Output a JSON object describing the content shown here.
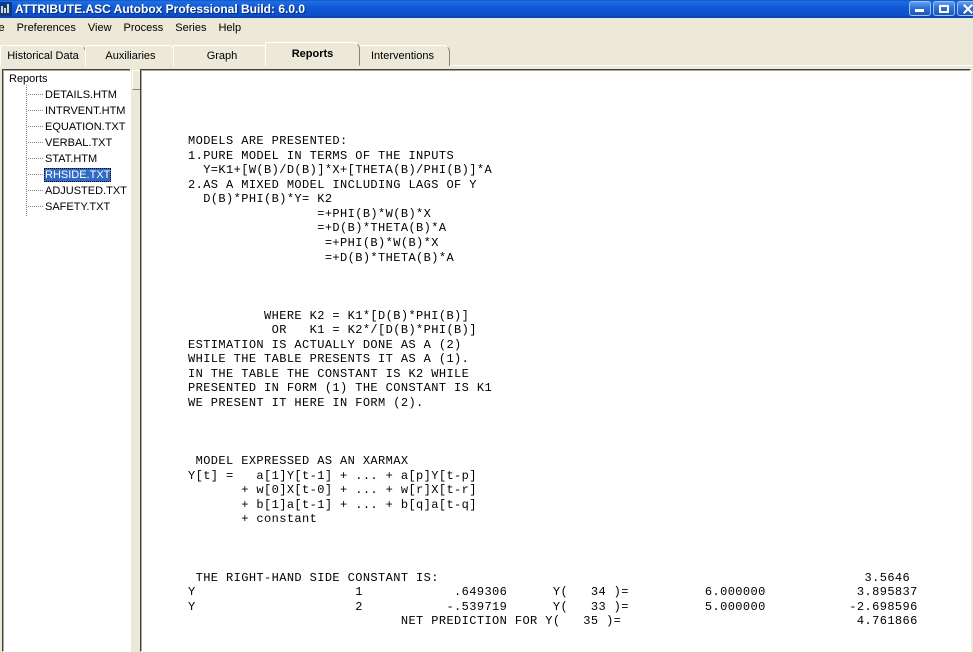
{
  "window": {
    "title": "ATTRIBUTE.ASC  Autobox Professional Build: 6.0.0",
    "icon": "app-icon",
    "buttons": [
      {
        "name": "minimize-button",
        "glyph": "minimize-icon"
      },
      {
        "name": "maximize-button",
        "glyph": "maximize-icon"
      },
      {
        "name": "close-button",
        "glyph": "close-icon"
      }
    ]
  },
  "menubar": {
    "items": [
      {
        "label": "le"
      },
      {
        "label": "Preferences"
      },
      {
        "label": "View"
      },
      {
        "label": "Process"
      },
      {
        "label": "Series"
      },
      {
        "label": "Help"
      }
    ]
  },
  "tabs": {
    "active": "Reports",
    "items": [
      {
        "label": "Historical Data",
        "left": 0,
        "width": 86,
        "active": false
      },
      {
        "label": "Auxiliaries",
        "left": 85,
        "width": 91,
        "active": false
      },
      {
        "label": "Graph",
        "left": 173,
        "width": 98,
        "active": false
      },
      {
        "label": "Reports",
        "left": 265,
        "width": 95,
        "active": true
      },
      {
        "label": "Interventions",
        "left": 355,
        "width": 95,
        "active": false
      }
    ]
  },
  "tree": {
    "root_label": "Reports",
    "items": [
      {
        "label": "DETAILS.HTM",
        "selected": false
      },
      {
        "label": "INTRVENT.HTM",
        "selected": false
      },
      {
        "label": "EQUATION.TXT",
        "selected": false
      },
      {
        "label": "VERBAL.TXT",
        "selected": false
      },
      {
        "label": "STAT.HTM",
        "selected": false
      },
      {
        "label": "RHSIDE.TXT",
        "selected": true
      },
      {
        "label": "ADJUSTED.TXT",
        "selected": false
      },
      {
        "label": "SAFETY.TXT",
        "selected": false
      }
    ]
  },
  "report": {
    "filename": "RHSIDE.TXT",
    "body": "\n\n\n\n     MODELS ARE PRESENTED:\n     1.PURE MODEL IN TERMS OF THE INPUTS\n       Y=K1+[W(B)/D(B)]*X+[THETA(B)/PHI(B)]*A\n     2.AS A MIXED MODEL INCLUDING LAGS OF Y\n       D(B)*PHI(B)*Y= K2\n                      =+PHI(B)*W(B)*X\n                      =+D(B)*THETA(B)*A\n                       =+PHI(B)*W(B)*X\n                       =+D(B)*THETA(B)*A\n\n\n\n               WHERE K2 = K1*[D(B)*PHI(B)]\n                OR   K1 = K2*/[D(B)*PHI(B)]\n     ESTIMATION IS ACTUALLY DONE AS A (2)\n     WHILE THE TABLE PRESENTS IT AS A (1).\n     IN THE TABLE THE CONSTANT IS K2 WHILE\n     PRESENTED IN FORM (1) THE CONSTANT IS K1\n     WE PRESENT IT HERE IN FORM (2).\n\n\n\n      MODEL EXPRESSED AS AN XARMAX\n     Y[t] =   a[1]Y[t-1] + ... + a[p]Y[t-p]\n            + w[0]X[t-0] + ... + w[r]X[t-r]\n            + b[1]a[t-1] + ... + b[q]a[t-q]\n            + constant\n\n\n\n      THE RIGHT-HAND SIDE CONSTANT IS:                                                        3.5646\n     Y                     1            .649306      Y(   34 )=          6.000000            3.895837\n     Y                     2           -.539719      Y(   33 )=          5.000000           -2.698596\n                                 NET PREDICTION FOR Y(   35 )=                               4.761866"
  },
  "report_values": {
    "rhs_constant_label": "THE RIGHT-HAND SIDE CONSTANT IS:",
    "rhs_constant": "3.5646",
    "rows": [
      {
        "series": "Y",
        "lag": "1",
        "coefficient": ".649306",
        "ref_label": "Y(",
        "ref_index": "34",
        "ref_value": "6.000000",
        "contribution": "3.895837"
      },
      {
        "series": "Y",
        "lag": "2",
        "coefficient": "-.539719",
        "ref_label": "Y(",
        "ref_index": "33",
        "ref_value": "5.000000",
        "contribution": "-2.698596"
      }
    ],
    "net_prediction_label": "NET PREDICTION FOR Y(",
    "net_prediction_index": "35",
    "net_prediction_value": "4.761866"
  },
  "colors": {
    "titlebar_blue": "#0d52c8",
    "selection_blue": "#316ac5",
    "face": "#ece9d8",
    "content_bg": "#ffffff",
    "text": "#000000"
  }
}
